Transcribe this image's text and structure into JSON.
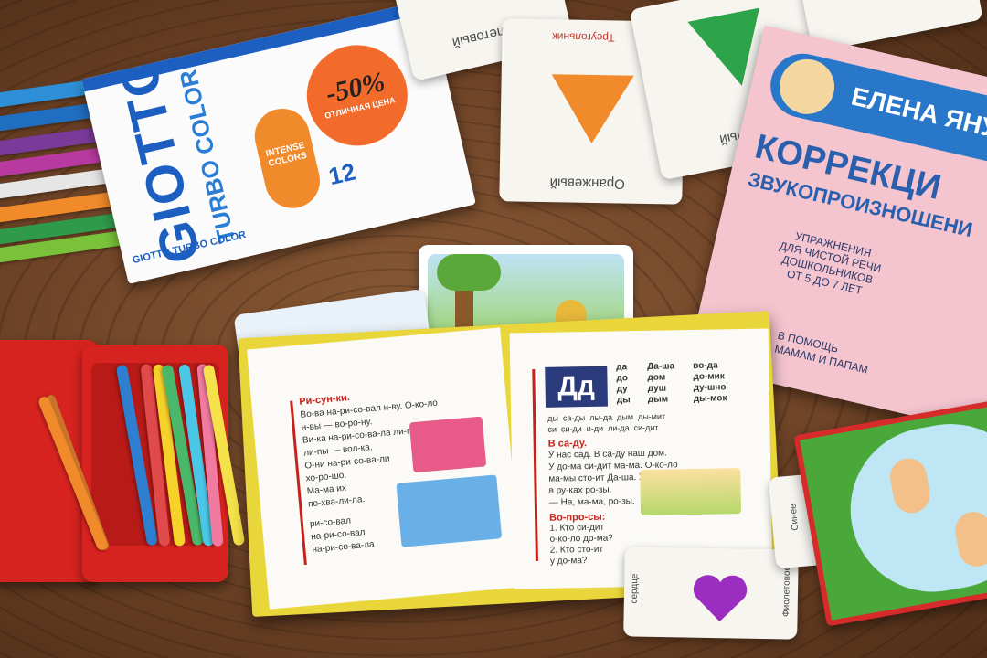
{
  "scene": {
    "marker_box": {
      "brand": "GIOTTO",
      "line": "TURBO COLOR",
      "count": "12",
      "discount": "-50%",
      "price_label": "ОТЛИЧНАЯ ЦЕНА",
      "feature": "INTENSE COLORS",
      "spine": "GIOTTO TURBO COLOR"
    },
    "shape_cards": [
      {
        "label": "Фиолетовый"
      },
      {
        "label": "Треугольник"
      },
      {
        "label": "Оранжевый",
        "color": "#f08a2a"
      },
      {
        "label": "Зелёный",
        "color": "#2ea44a"
      },
      {
        "label": "Синее"
      },
      {
        "label": "Фиолетовое",
        "color": "#9b2ec0"
      },
      {
        "label": "сердце"
      }
    ],
    "speech_book": {
      "author": "ЕЛЕНА ЯНУШ",
      "title1": "КОРРЕКЦИ",
      "title2": "ЗВУКОПРОИЗНОШЕНИ",
      "subtitle": "УПРАЖНЕНИЯ\nДЛЯ ЧИСТОЙ РЕЧИ\nДОШКОЛЬНИКОВ\nОТ 5 ДО 7 ЛЕТ",
      "note": "В ПОМОЩЬ\nМАМАМ И ПАПАМ",
      "color": "#f4c4cf"
    },
    "primer": {
      "left_heading": "Ри-сун-ки.",
      "left_text": "Во-ва на-ри-со-вал н-ву. О-ко-ло\nн-вы — во-ро-ну.\nВи-ка на-ри-со-ва-ла ли-пу. О-ко-ло\nли-пы — вол-ка.\nО-ни на-ри-со-ва-ли\nхо-ро-шо.\nМа-ма их\nпо-хва-ли-ла.",
      "left_words": "ри-со-вал\nна-ри-со-вал\nна-ри-со-ва-ла",
      "letter": "Дд",
      "syll_col1": "да\nдо\nду\nды",
      "syll_col2": "Да-ша\nдом\nдуш\nдым",
      "syll_col3": "во-да\nдо-мик\nду-шно\nды-мок",
      "syll_row": "ды  са-ды  лы-да  дым  ды-мит\nси  си-ди  и-ди  ли-да  си-дит",
      "story_heading": "В са-ду.",
      "story_text": "У нас сад. В са-ду наш дом.\nУ до-ма си-дит ма-ма. О-ко-ло\nма-мы сто-ит Да-ша. У Да-ши\nв ру-ках ро-зы.\n— На, ма-ма, ро-зы.",
      "q_heading": "Во-про-сы:",
      "q_text": "1. Кто си-дит\nо-ко-ло до-ма?\n2. Кто сто-ит\nу до-ма?"
    },
    "colors": {
      "pencil_case": "#d7231f",
      "primer_cover": "#e9d63a",
      "letter_box": "#2a3a7a"
    }
  }
}
